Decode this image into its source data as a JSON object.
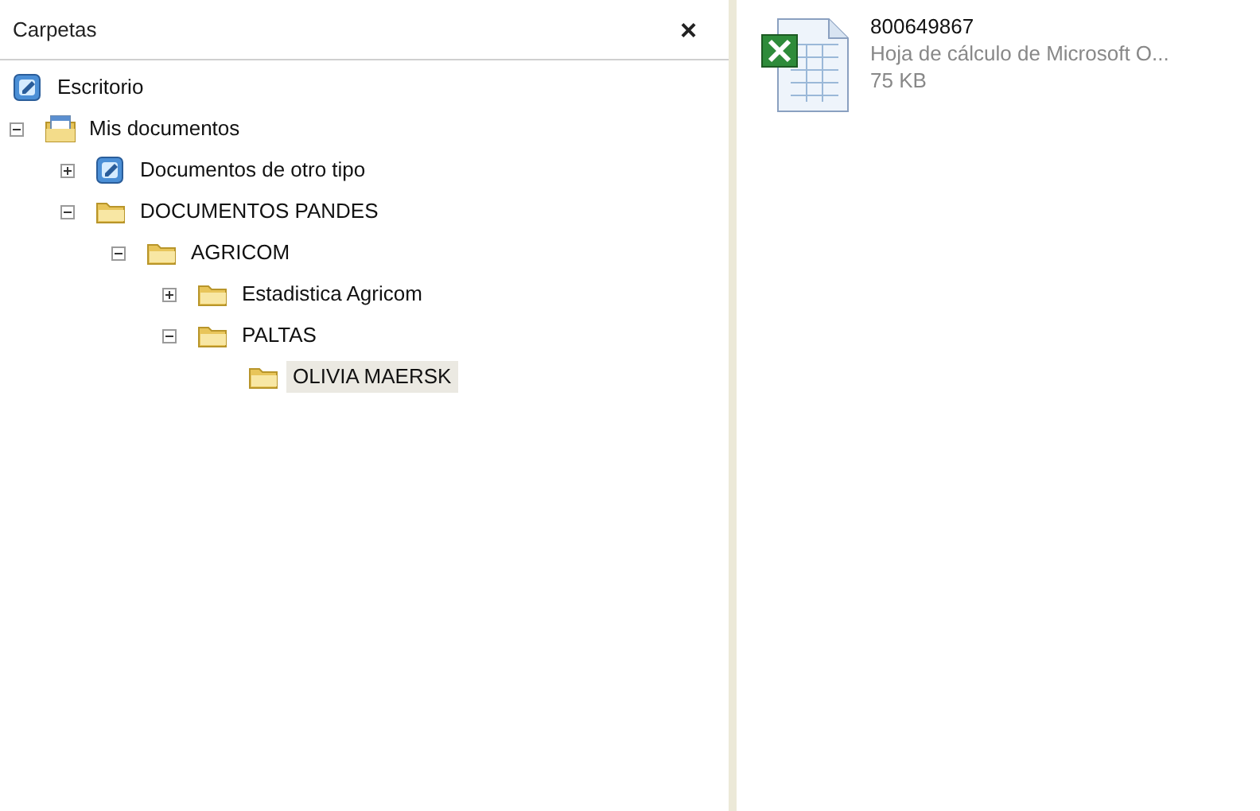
{
  "folders_pane": {
    "title": "Carpetas",
    "close": "×",
    "tree": [
      {
        "label": "Escritorio",
        "kind": "desktop",
        "selected": false,
        "children": [
          {
            "label": "Mis documentos",
            "kind": "documents",
            "expanded": true,
            "selected": false,
            "children": [
              {
                "label": "Documentos de otro tipo",
                "kind": "desktop",
                "expanded": false,
                "selected": false
              },
              {
                "label": "DOCUMENTOS PANDES",
                "kind": "folder",
                "expanded": true,
                "selected": false,
                "children": [
                  {
                    "label": "AGRICOM",
                    "kind": "folder",
                    "expanded": true,
                    "selected": false,
                    "children": [
                      {
                        "label": "Estadistica Agricom",
                        "kind": "folder",
                        "expanded": false,
                        "selected": false
                      },
                      {
                        "label": "PALTAS",
                        "kind": "folder",
                        "expanded": true,
                        "selected": false,
                        "children": [
                          {
                            "label": "OLIVIA MAERSK",
                            "kind": "folder",
                            "selected": true
                          }
                        ]
                      }
                    ]
                  }
                ]
              }
            ]
          }
        ]
      }
    ]
  },
  "files": [
    {
      "name": "800649867",
      "type": "Hoja de cálculo de Microsoft O...",
      "size": "75 KB"
    }
  ]
}
